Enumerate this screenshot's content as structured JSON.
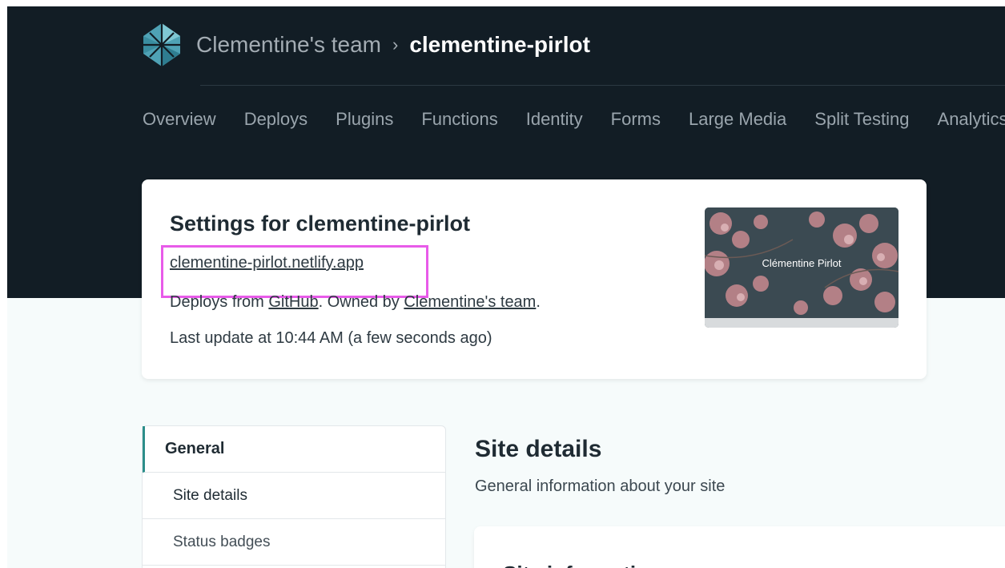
{
  "header": {
    "team_name": "Clementine's team",
    "separator": "›",
    "site_name": "clementine-pirlot"
  },
  "nav": {
    "items": [
      "Overview",
      "Deploys",
      "Plugins",
      "Functions",
      "Identity",
      "Forms",
      "Large Media",
      "Split Testing",
      "Analytics"
    ]
  },
  "site_card": {
    "title": "Settings for clementine-pirlot",
    "url": "clementine-pirlot.netlify.app",
    "deploys_prefix": "Deploys from ",
    "deploys_source": "GitHub",
    "owned_prefix": ". Owned by ",
    "owner": "Clementine's team",
    "owned_suffix": ".",
    "last_update": "Last update at 10:44 AM (a few seconds ago)",
    "preview_caption": "Clémentine Pirlot"
  },
  "sidebar": {
    "section": "General",
    "items": [
      "Site details",
      "Status badges"
    ]
  },
  "main": {
    "title": "Site details",
    "subtitle": "General information about your site",
    "card_title": "Site information"
  },
  "colors": {
    "header_bg": "#121d25",
    "highlight": "#e85be9",
    "accent": "#2c8e8a"
  }
}
